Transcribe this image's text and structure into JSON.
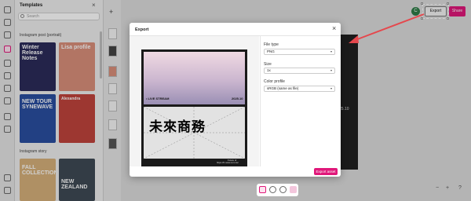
{
  "panel": {
    "title": "Templates",
    "search_placeholder": "Search",
    "section1": "Instagram post (portrait)",
    "section2": "Instagram story",
    "cards": [
      {
        "title": "Winter Release Notes",
        "bg": "#2b2b5a",
        "color": "#ffffff"
      },
      {
        "title": "Lisa profile",
        "bg": "#d98f7b",
        "color": "#ffffff"
      },
      {
        "title": "NEW TOUR SYNEWAVE",
        "bg": "#2a4fa0",
        "color": "#ffffff"
      },
      {
        "title": "Alexandra",
        "bg": "#c0443c",
        "color": "#ffffff"
      },
      {
        "title": "FALL COLLECTION",
        "bg": "#d6b07a",
        "color": "#ffffff"
      },
      {
        "title": "NEW ZEALAND",
        "bg": "#3f4a55",
        "color": "#ffffff"
      }
    ]
  },
  "topbar": {
    "avatar": "C",
    "export_label": "Export",
    "share_label": "Share"
  },
  "behind_design": {
    "date": "25.10"
  },
  "modal": {
    "title": "Export",
    "close": "×",
    "design": {
      "livestream": "• LIVE STREAM",
      "date": "2025.10",
      "big_title": "未來商務",
      "small_text": "Future of",
      "url": "https://fc.www.com.tw/"
    },
    "file_type_label": "File type",
    "file_type_value": "PNG",
    "size_label": "Size",
    "size_value": "1x",
    "color_profile_label": "Color profile",
    "color_profile_value": "sRGB (same as file)",
    "export_asset_label": "Export asset"
  },
  "zoom": {
    "minus": "−",
    "plus": "+",
    "help": "?"
  },
  "colors": {
    "accent": "#e0187a",
    "arrow": "#e5484d"
  }
}
